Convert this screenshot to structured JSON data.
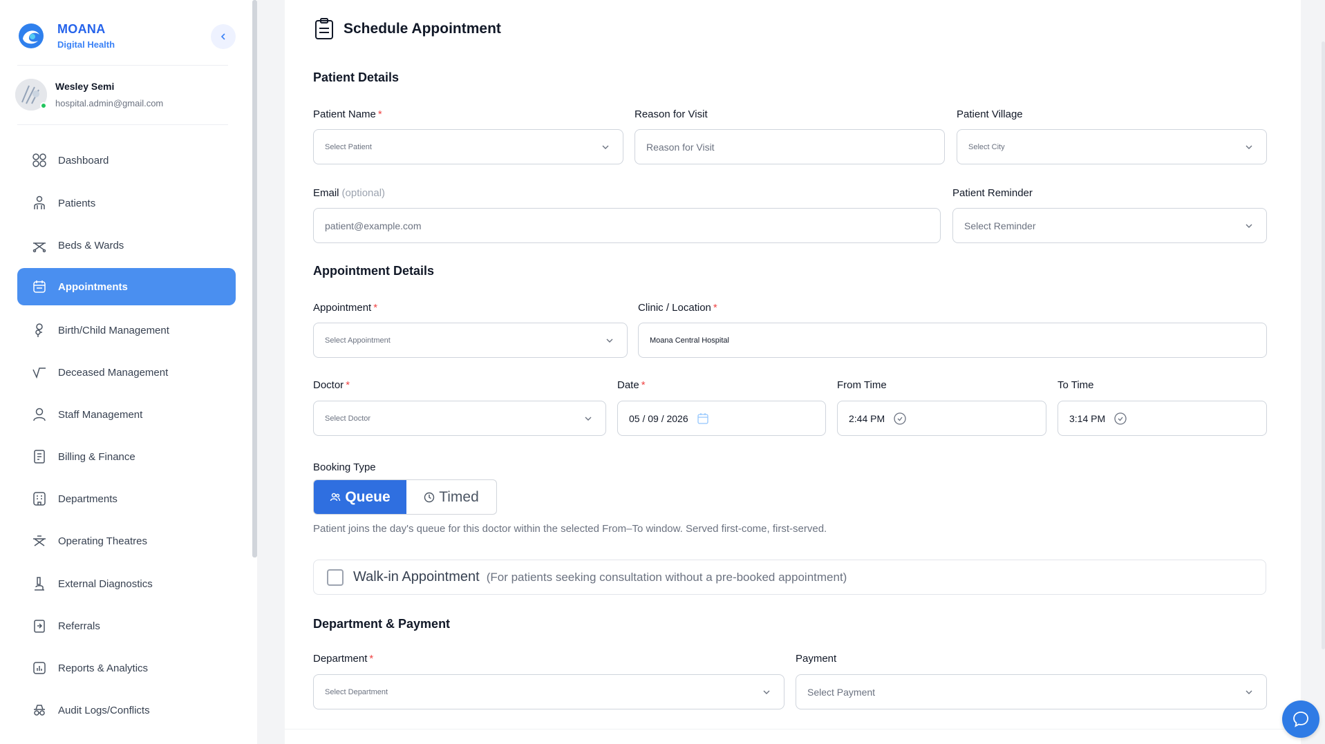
{
  "brand": {
    "name": "MOANA",
    "subtitle": "Digital Health"
  },
  "user": {
    "name": "Wesley Semi",
    "email": "hospital.admin@gmail.com"
  },
  "sidebar": {
    "items": [
      {
        "label": "Dashboard",
        "icon": "grid-icon"
      },
      {
        "label": "Patients",
        "icon": "person-icon"
      },
      {
        "label": "Beds & Wards",
        "icon": "bed-icon"
      },
      {
        "label": "Appointments",
        "icon": "calendar-icon",
        "active": true
      },
      {
        "label": "Birth/Child Management",
        "icon": "baby-icon"
      },
      {
        "label": "Deceased Management",
        "icon": "pulse-icon"
      },
      {
        "label": "Staff Management",
        "icon": "user-icon"
      },
      {
        "label": "Billing & Finance",
        "icon": "invoice-icon"
      },
      {
        "label": "Departments",
        "icon": "building-icon"
      },
      {
        "label": "Operating Theatres",
        "icon": "theatre-icon"
      },
      {
        "label": "External Diagnostics",
        "icon": "microscope-icon"
      },
      {
        "label": "Referrals",
        "icon": "referral-icon"
      },
      {
        "label": "Reports & Analytics",
        "icon": "chart-icon"
      },
      {
        "label": "Audit Logs/Conflicts",
        "icon": "spy-icon"
      }
    ]
  },
  "page": {
    "title": "Schedule Appointment"
  },
  "patient_details": {
    "title": "Patient Details",
    "patient_name": {
      "label": "Patient Name",
      "placeholder": "Select Patient"
    },
    "reason": {
      "label": "Reason for Visit",
      "placeholder": "Reason for Visit"
    },
    "village": {
      "label": "Patient Village",
      "placeholder": "Select City"
    },
    "email": {
      "label": "Email",
      "optional": "(optional)",
      "placeholder": "patient@example.com"
    },
    "reminder": {
      "label": "Patient Reminder",
      "placeholder": "Select Reminder"
    }
  },
  "appointment_details": {
    "title": "Appointment Details",
    "appointment": {
      "label": "Appointment",
      "placeholder": "Select Appointment"
    },
    "clinic": {
      "label": "Clinic / Location",
      "value": "Moana Central Hospital"
    },
    "doctor": {
      "label": "Doctor",
      "placeholder": "Select Doctor"
    },
    "date": {
      "label": "Date",
      "value": "05 / 09 / 2026"
    },
    "from_time": {
      "label": "From Time",
      "value": "2:44 PM"
    },
    "to_time": {
      "label": "To Time",
      "value": "3:14 PM"
    },
    "booking": {
      "label": "Booking Type",
      "queue_label": "Queue",
      "timed_label": "Timed",
      "selected": "Queue",
      "help": "Patient joins the day's queue for this doctor within the selected From–To window. Served first-come, first-served."
    },
    "walkin": {
      "label": "Walk-in Appointment",
      "description": "(For patients seeking consultation without a pre-booked appointment)",
      "checked": false
    }
  },
  "department_payment": {
    "title": "Department & Payment",
    "department": {
      "label": "Department",
      "placeholder": "Select Department"
    },
    "payment": {
      "label": "Payment",
      "placeholder": "Select Payment"
    }
  },
  "colors": {
    "primary": "#2f6fe0",
    "sidebar_active": "#4a8ff0",
    "required": "#ef4444",
    "online": "#22c55e"
  }
}
